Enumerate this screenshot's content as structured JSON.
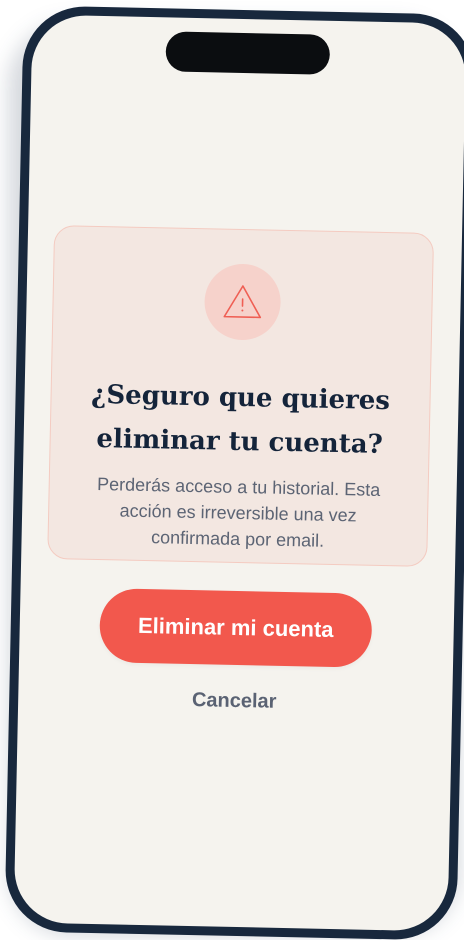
{
  "dialog": {
    "title": "¿Seguro que quieres eliminar tu cuenta?",
    "message": "Perderás acceso a tu historial. Esta acción es irreversible una vez confirmada por email.",
    "icon": "warning-triangle-icon",
    "confirm_label": "Eliminar mi cuenta",
    "cancel_label": "Cancelar"
  },
  "colors": {
    "accent": "#f2584d",
    "screen_background": "#f5f3ee",
    "card_background": "#f3e7e1",
    "title_text": "#14243a",
    "secondary_text": "#5c6474"
  }
}
